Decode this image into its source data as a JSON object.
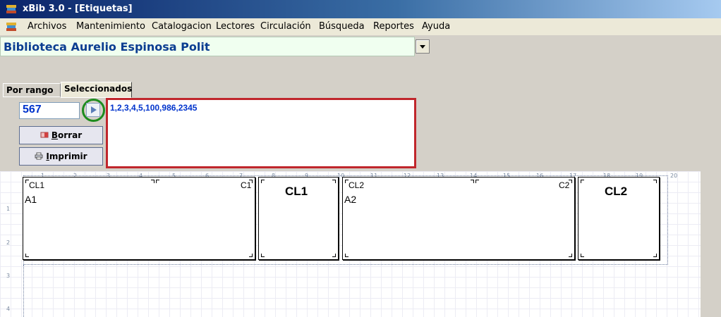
{
  "window": {
    "title": "xBib 3.0 - [Etiquetas]"
  },
  "menu": [
    "Archivos",
    "Mantenimiento",
    "Catalogacion",
    "Lectores",
    "Circulación",
    "Búsqueda",
    "Reportes",
    "Ayuda"
  ],
  "library": {
    "selected": "Biblioteca Aurelio Espinosa Polit"
  },
  "tabs": {
    "rango": "Por rango",
    "seleccionados": "Seleccionados"
  },
  "selector": {
    "input_value": "567",
    "list_text": "1,2,3,4,5,100,986,2345"
  },
  "buttons": {
    "borrar": "orrar",
    "borrar_key": "B",
    "imprimir": "mprimir",
    "imprimir_key": "I"
  },
  "ruler": {
    "top": [
      "1",
      "2",
      "3",
      "4",
      "5",
      "6",
      "7",
      "8",
      "9",
      "10",
      "11",
      "12",
      "13",
      "14",
      "15",
      "16",
      "17",
      "18",
      "19",
      "20"
    ],
    "left": [
      "1",
      "2",
      "3",
      "4"
    ]
  },
  "labels": {
    "l1": {
      "top_left": "CL1",
      "top_right": "C1",
      "main": "A1"
    },
    "l2": {
      "main": "CL1"
    },
    "l3": {
      "top_left": "CL2",
      "top_right": "C2",
      "main": "A2"
    },
    "l4": {
      "main": "CL2"
    }
  },
  "colors": {
    "accent_highlight": "#c0262c",
    "go_ring": "#1e8c1e",
    "library_text": "#0b3d91"
  },
  "icons": {
    "app": "books-stack-icon",
    "go": "play-arrow-icon",
    "borrar": "eraser-icon",
    "imprimir": "printer-icon"
  }
}
